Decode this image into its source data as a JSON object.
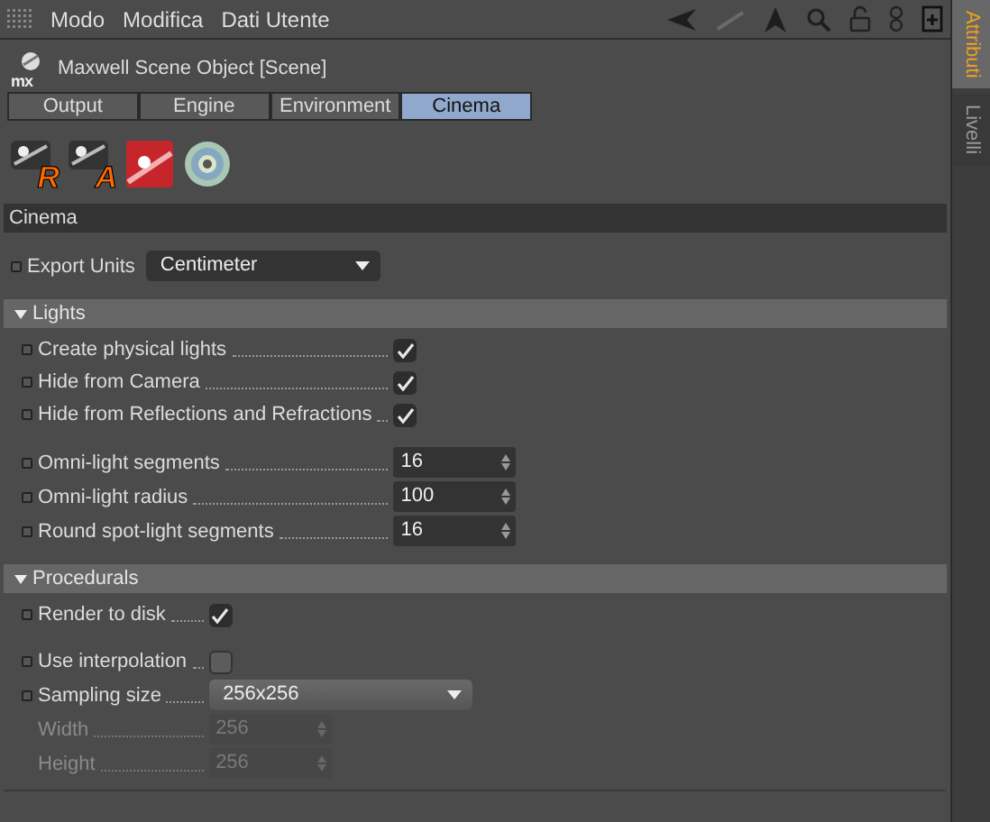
{
  "menu": [
    "Modo",
    "Modifica",
    "Dati Utente"
  ],
  "object": {
    "logo_text": "mx",
    "title": "Maxwell Scene Object [Scene]"
  },
  "tabs": [
    {
      "label": "Output",
      "selected": false
    },
    {
      "label": "Engine",
      "selected": false
    },
    {
      "label": "Environment",
      "selected": false
    },
    {
      "label": "Cinema",
      "selected": true
    }
  ],
  "presets": [
    {
      "kind": "render",
      "letter": "R"
    },
    {
      "kind": "render",
      "letter": "A"
    },
    {
      "kind": "red"
    },
    {
      "kind": "disc"
    }
  ],
  "section": "Cinema",
  "export_units": {
    "label": "Export Units",
    "value": "Centimeter"
  },
  "groups": [
    {
      "title": "Lights",
      "expanded": true,
      "blocks": [
        [
          {
            "kind": "checkbox",
            "label": "Create physical lights",
            "checked": true,
            "disabled": false
          },
          {
            "kind": "checkbox",
            "label": "Hide from Camera",
            "checked": true,
            "disabled": false
          },
          {
            "kind": "checkbox",
            "label": "Hide from Reflections and Refractions",
            "checked": true,
            "disabled": false
          }
        ],
        [
          {
            "kind": "number",
            "label": "Omni-light segments",
            "value": "16",
            "disabled": false
          },
          {
            "kind": "number",
            "label": "Omni-light radius",
            "value": "100",
            "disabled": false
          },
          {
            "kind": "number",
            "label": "Round spot-light segments",
            "value": "16",
            "disabled": false
          }
        ]
      ]
    },
    {
      "title": "Procedurals",
      "expanded": true,
      "blocks": [
        [
          {
            "kind": "checkbox",
            "label": "Render to disk",
            "checked": true,
            "disabled": false
          }
        ],
        [
          {
            "kind": "checkbox",
            "label": "Use interpolation",
            "checked": false,
            "disabled": false
          },
          {
            "kind": "dropdown",
            "label": "Sampling size",
            "value": "256x256",
            "disabled": false
          },
          {
            "kind": "number",
            "label": "Width",
            "value": "256",
            "disabled": true
          },
          {
            "kind": "number",
            "label": "Height",
            "value": "256",
            "disabled": true
          }
        ]
      ]
    }
  ],
  "side_tabs": [
    {
      "label": "Attributi",
      "selected": true
    },
    {
      "label": "Livelli",
      "selected": false
    }
  ]
}
